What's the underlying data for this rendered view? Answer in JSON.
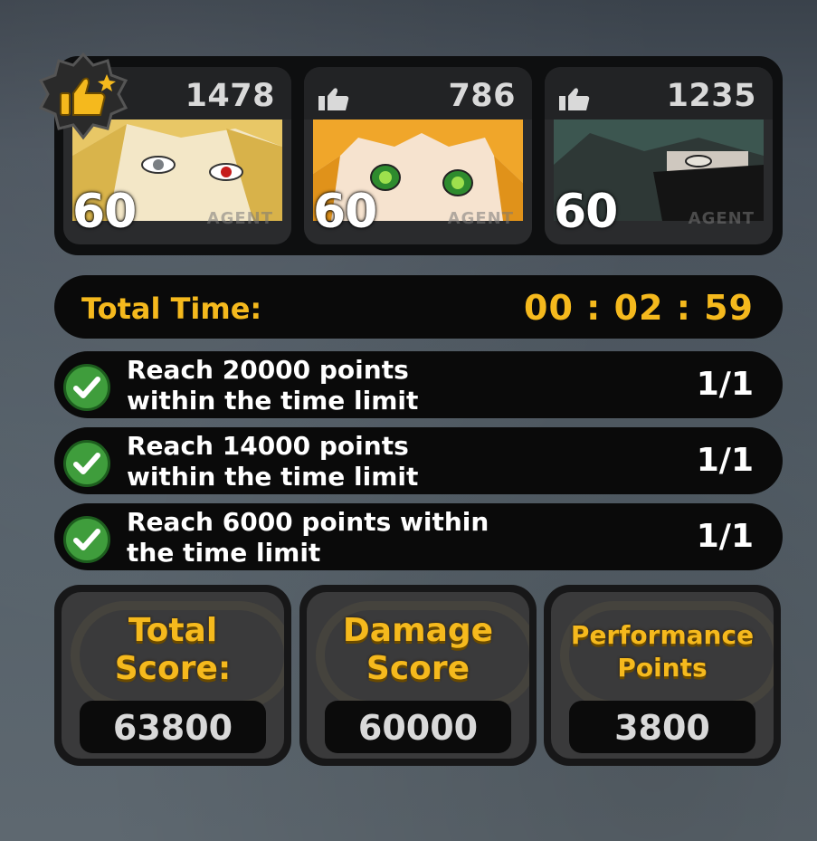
{
  "agents": [
    {
      "likes": "1478",
      "level": "60",
      "tag": "AGENT"
    },
    {
      "likes": "786",
      "level": "60",
      "tag": "AGENT"
    },
    {
      "likes": "1235",
      "level": "60",
      "tag": "AGENT"
    }
  ],
  "time": {
    "label": "Total Time:",
    "value": "00 : 02 : 59"
  },
  "tasks": [
    {
      "line1": "Reach 20000 points",
      "line2": "within the time limit",
      "count": "1/1"
    },
    {
      "line1": "Reach 14000 points",
      "line2": "within the time limit",
      "count": "1/1"
    },
    {
      "line1": "Reach 6000 points within",
      "line2": "the time limit",
      "count": "1/1"
    }
  ],
  "scores": [
    {
      "label1": "Total",
      "label2": "Score:",
      "value": "63800"
    },
    {
      "label1": "Damage",
      "label2": "Score",
      "value": "60000"
    },
    {
      "label1": "Performance",
      "label2": "Points",
      "value": "3800"
    }
  ],
  "colors": {
    "accent": "#f5b91d",
    "check": "#3f9d3c",
    "panel": "#0a0a0a"
  }
}
